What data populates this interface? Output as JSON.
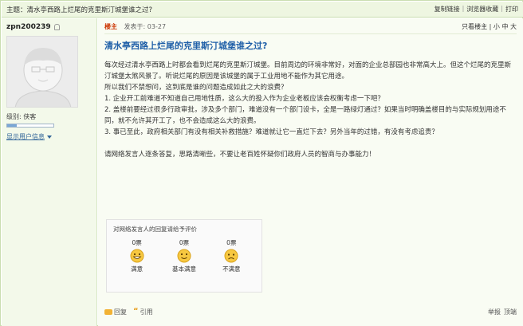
{
  "topbar": {
    "subject_label": "主题：",
    "subject_title": "清水亭西路上烂尾的克里斯汀城堡谁之过?",
    "actions": [
      "复制链接",
      "浏览器收藏",
      "打印"
    ]
  },
  "user": {
    "name": "zpn200239",
    "level_label": "级别: 侠客",
    "level_fill": 0.2,
    "show_info": "显示用户信息"
  },
  "post": {
    "lz_label": "楼主",
    "posted_at": "发表于: 03-27",
    "view_options": "只看楼主 | 小 中 大",
    "title": "清水亭西路上烂尾的克里斯汀城堡谁之过?",
    "paragraphs": [
      "每次经过清水亭西路上时都会看到烂尾的克里斯汀城堡。目前周边的环境非常好，对面的企业总部园也非常高大上。但这个烂尾的克里斯汀城堡太煞风景了。听说烂尾的原因是该城堡的属于工业用地不能作为其它用途。",
      "所以我们不禁想问，这到底是谁的问题造成如此之大的浪费？",
      "1. 企业开工前难道不知道自己用地性质，这么大的投入作为企业老板应该会权衡考虑一下吧？",
      "2. 盖楼前要经过很多行政审批，涉及多个部门，难道没有一个部门设卡，全是一路绿灯通过？如果当时明确盖楼目的与实际规划用途不同，就不允许其开工了，也不会造成这么大的浪费。",
      "3. 事已至此，政府相关部门有没有相关补救措施？难道就让它一直烂下去？另外当年的过错，有没有考虑追责？",
      "",
      "请网络发言人逐条答复，思路清晰些，不要让老百姓怀疑你们政府人员的智商与办事能力！"
    ]
  },
  "rating": {
    "title": "对网络发言人的回复请给予评价",
    "options": [
      {
        "count": "0票",
        "label": "满意"
      },
      {
        "count": "0票",
        "label": "基本满意"
      },
      {
        "count": "0票",
        "label": "不满意"
      }
    ]
  },
  "bottom": {
    "reply": "回复",
    "quote": "引用",
    "report": "举报",
    "top": "顶端"
  }
}
